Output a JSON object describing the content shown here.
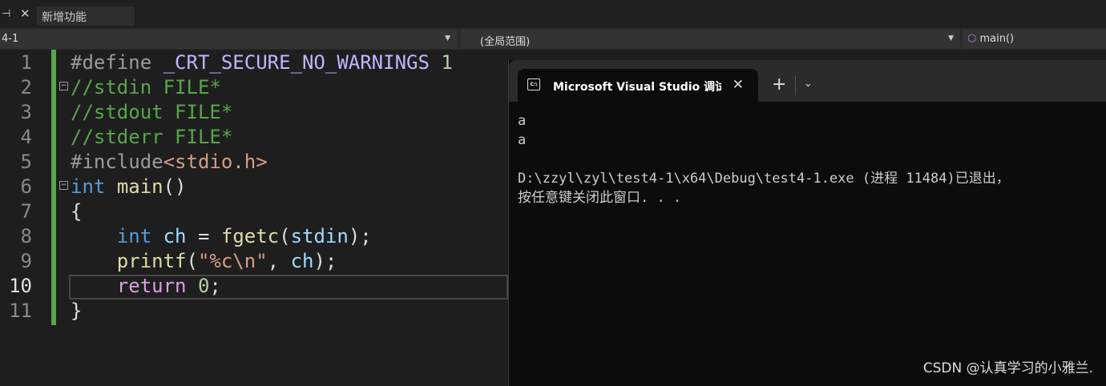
{
  "tabs": {
    "pin_icon": "pin-icon",
    "close_icon": "close-icon",
    "feature_tab": "新增功能"
  },
  "nav": {
    "project": "4-1",
    "scope": "(全局范围)",
    "member": "main()"
  },
  "editor": {
    "current_line": 10,
    "lines": [
      {
        "n": "1",
        "tokens": [
          [
            "#define ",
            "pp"
          ],
          [
            "_CRT_SECURE_NO_WARNINGS",
            "m"
          ],
          [
            " 1",
            "n"
          ]
        ]
      },
      {
        "n": "2",
        "tokens": [
          [
            "//stdin FILE*",
            "c"
          ]
        ]
      },
      {
        "n": "3",
        "tokens": [
          [
            "//stdout FILE*",
            "c"
          ]
        ]
      },
      {
        "n": "4",
        "tokens": [
          [
            "//stderr FILE*",
            "c"
          ]
        ]
      },
      {
        "n": "5",
        "tokens": [
          [
            "#include",
            "pp"
          ],
          [
            "<stdio.h>",
            "inc"
          ]
        ]
      },
      {
        "n": "6",
        "tokens": [
          [
            "int",
            "k"
          ],
          [
            " ",
            "t"
          ],
          [
            "main",
            "f"
          ],
          [
            "()",
            "t"
          ]
        ]
      },
      {
        "n": "7",
        "tokens": [
          [
            "{",
            "t"
          ]
        ]
      },
      {
        "n": "8",
        "tokens": [
          [
            "    ",
            "t"
          ],
          [
            "int",
            "k"
          ],
          [
            " ",
            "t"
          ],
          [
            "ch",
            "v"
          ],
          [
            " = ",
            "t"
          ],
          [
            "fgetc",
            "f"
          ],
          [
            "(",
            "t"
          ],
          [
            "stdin",
            "v"
          ],
          [
            ");",
            "t"
          ]
        ]
      },
      {
        "n": "9",
        "tokens": [
          [
            "    ",
            "t"
          ],
          [
            "printf",
            "f"
          ],
          [
            "(",
            "t"
          ],
          [
            "\"%c\\n\"",
            "s"
          ],
          [
            ", ",
            "t"
          ],
          [
            "ch",
            "v"
          ],
          [
            ");",
            "t"
          ]
        ]
      },
      {
        "n": "10",
        "tokens": [
          [
            "    ",
            "t"
          ],
          [
            "return",
            "r"
          ],
          [
            " ",
            "t"
          ],
          [
            "0",
            "n"
          ],
          [
            ";",
            "t"
          ]
        ]
      },
      {
        "n": "11",
        "tokens": [
          [
            "}",
            "t"
          ]
        ]
      }
    ]
  },
  "terminal": {
    "tab_title": "Microsoft Visual Studio 调试控",
    "output": [
      "a",
      "a",
      "",
      "D:\\zzyl\\zyl\\test4-1\\x64\\Debug\\test4-1.exe (进程 11484)已退出，",
      "按任意键关闭此窗口. . ."
    ],
    "plus": "+",
    "chevron": "⌄",
    "close": "✕"
  },
  "watermark": "CSDN @认真学习的小雅兰."
}
